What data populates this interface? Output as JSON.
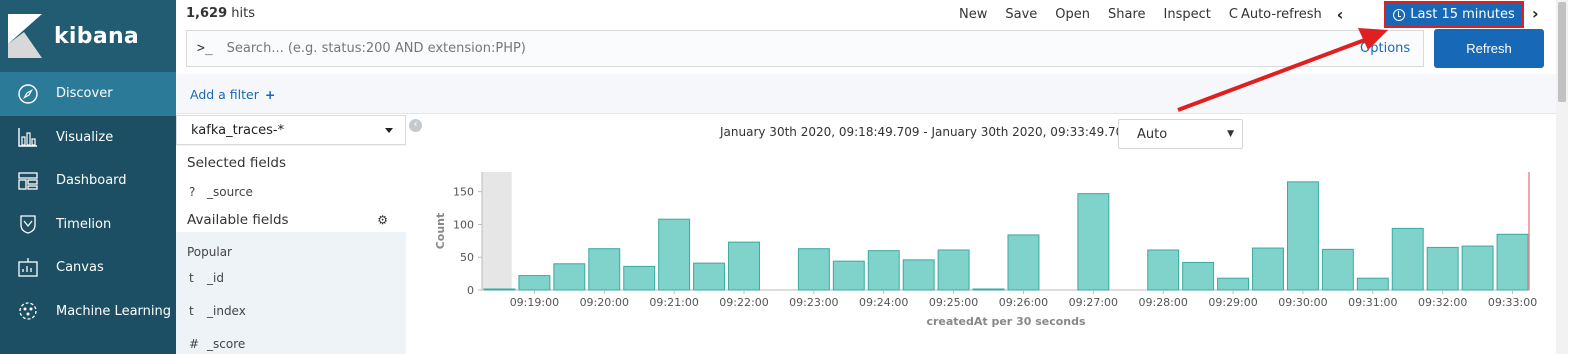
{
  "app": {
    "logo_text": "kibana"
  },
  "sidebar": {
    "items": [
      {
        "label": "Discover",
        "icon": "compass-icon"
      },
      {
        "label": "Visualize",
        "icon": "bar-chart-icon"
      },
      {
        "label": "Dashboard",
        "icon": "dashboard-icon"
      },
      {
        "label": "Timelion",
        "icon": "shield-icon"
      },
      {
        "label": "Canvas",
        "icon": "canvas-icon"
      },
      {
        "label": "Machine Learning",
        "icon": "ml-icon"
      }
    ]
  },
  "header": {
    "hits_count": "1,629",
    "hits_label": " hits",
    "menu": {
      "new": "New",
      "save": "Save",
      "open": "Open",
      "share": "Share",
      "inspect": "Inspect",
      "auto_refresh": "Auto-refresh"
    },
    "time_picker": "Last 15 minutes",
    "refresh_glyph": "C"
  },
  "search": {
    "prompt": ">_",
    "placeholder": "Search... (e.g. status:200 AND extension:PHP)",
    "options_label": "Options",
    "refresh_label": "Refresh"
  },
  "filters": {
    "add_label": "Add a filter",
    "add_glyph": "+"
  },
  "fields_panel": {
    "index_pattern": "kafka_traces-*",
    "selected_heading": "Selected fields",
    "selected": [
      {
        "type": "?",
        "name": "_source"
      }
    ],
    "available_heading": "Available fields",
    "popular_label": "Popular",
    "available": [
      {
        "type": "t",
        "name": "_id"
      },
      {
        "type": "t",
        "name": "_index"
      },
      {
        "type": "#",
        "name": "_score"
      }
    ],
    "collapse_glyph": "‹"
  },
  "chart_header": {
    "range": "January 30th 2020, 09:18:49.709 - January 30th 2020, 09:33:49.709 —",
    "interval": "Auto"
  },
  "colors": {
    "sidebar": "#1c4f63",
    "accent": "#1868b8",
    "bar": "#7fd3cb",
    "bar_stroke": "#3aaa9f",
    "highlight": "#e02020"
  },
  "chart_data": {
    "type": "bar",
    "title": "",
    "xlabel": "createdAt per 30 seconds",
    "ylabel": "Count",
    "ylim": [
      0,
      180
    ],
    "yticks": [
      0,
      50,
      100,
      150
    ],
    "x_tick_labels": [
      "09:19:00",
      "09:20:00",
      "09:21:00",
      "09:22:00",
      "09:23:00",
      "09:24:00",
      "09:25:00",
      "09:26:00",
      "09:27:00",
      "09:28:00",
      "09:29:00",
      "09:30:00",
      "09:31:00",
      "09:32:00",
      "09:33:00"
    ],
    "categories": [
      "09:18:30",
      "09:19:00",
      "09:19:30",
      "09:20:00",
      "09:20:30",
      "09:21:00",
      "09:21:30",
      "09:22:00",
      "09:22:30",
      "09:23:00",
      "09:23:30",
      "09:24:00",
      "09:24:30",
      "09:25:00",
      "09:25:30",
      "09:26:00",
      "09:26:30",
      "09:27:00",
      "09:27:30",
      "09:28:00",
      "09:28:30",
      "09:29:00",
      "09:29:30",
      "09:30:00",
      "09:30:30",
      "09:31:00",
      "09:31:30",
      "09:32:00",
      "09:32:30",
      "09:33:00"
    ],
    "values": [
      1,
      22,
      40,
      63,
      36,
      108,
      41,
      73,
      0,
      63,
      44,
      60,
      46,
      61,
      1,
      84,
      0,
      147,
      0,
      61,
      42,
      18,
      64,
      165,
      62,
      18,
      94,
      65,
      67,
      85
    ],
    "grid": false,
    "legend": "none"
  }
}
